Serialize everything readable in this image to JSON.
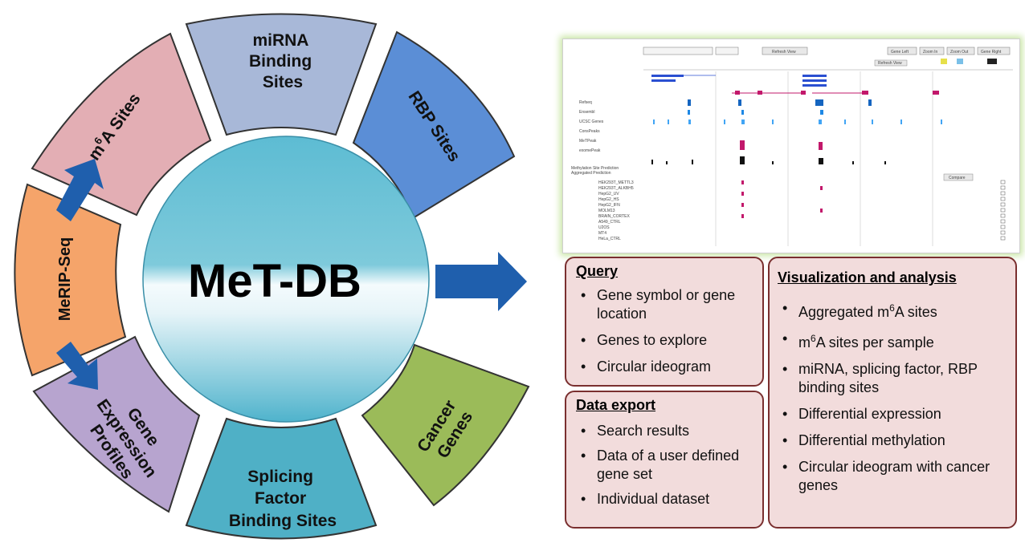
{
  "wheel": {
    "center_label": "MeT-DB",
    "segments": {
      "mirna": [
        "miRNA",
        "Binding",
        "Sites"
      ],
      "rbp": [
        "RBP Sites"
      ],
      "cancer": [
        "Cancer",
        "Genes"
      ],
      "splicing": [
        "Splicing",
        "Factor",
        "Binding Sites"
      ],
      "gene_expression": [
        "Gene",
        "Expression",
        "Profiles"
      ],
      "merip": [
        "MeRIP-Seq"
      ],
      "m6a": {
        "base": "m",
        "sup": "6",
        "rest": "A Sites"
      }
    }
  },
  "screenshot": {
    "tracks": [
      "Refseq",
      "Ensembl",
      "UCSC Genes",
      "ConsPeaks",
      "MeTPeak",
      "exomePeak",
      "Methylation Site Prediction",
      "Aggregated Prediction"
    ],
    "sample_rows": [
      "HEK293T_METTL3",
      "HEK293T_ALKBH5",
      "HepG2_UV",
      "HepG2_HS",
      "HepG2_IFN",
      "MOLM13",
      "BRAIN_CORTEX",
      "A549_CTRL",
      "U2OS",
      "MT4",
      "HeLa_CTRL"
    ],
    "buttons": [
      "Refresh View",
      "Gene Left",
      "Zoom In",
      "Zoom Out",
      "Gene Right",
      "Compare"
    ]
  },
  "panels": {
    "query": {
      "title": "Query",
      "items": [
        "Gene symbol or gene location",
        "Genes to explore",
        "Circular ideogram"
      ]
    },
    "export": {
      "title": "Data export",
      "items": [
        "Search results",
        "Data of a user defined gene set",
        "Individual dataset"
      ]
    },
    "viz": {
      "title": "Visualization and analysis",
      "items": [
        {
          "base": "Aggregated m",
          "sup": "6",
          "rest": "A sites"
        },
        {
          "base": "m",
          "sup": "6",
          "rest": "A sites per sample"
        },
        "miRNA, splicing factor, RBP binding sites",
        "Differential expression",
        "Differential methylation",
        "Circular ideogram with cancer genes"
      ]
    }
  },
  "colors": {
    "mirna": "#a8b8d8",
    "rbp": "#5b8ed6",
    "cancer": "#9bbb59",
    "splicing": "#4fb0c6",
    "gene_expression": "#b7a4cf",
    "merip": "#f5a46a",
    "m6a": "#e3aeb4",
    "center": "#6bc3d6",
    "arrow": "#1f5fad",
    "panel_bg": "#f2dcdc",
    "panel_border": "#7a2f2f"
  }
}
